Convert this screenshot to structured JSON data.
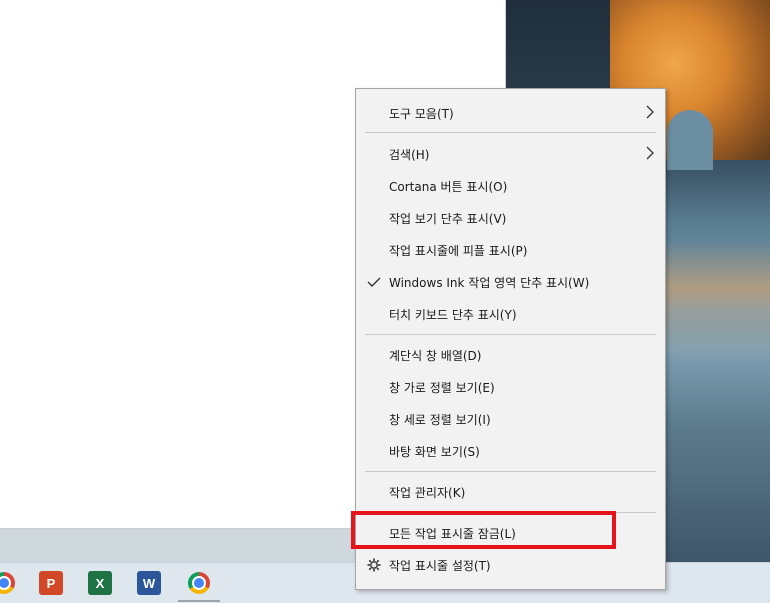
{
  "context_menu": {
    "items": {
      "toolbars": "도구 모음(T)",
      "search": "검색(H)",
      "cortana": "Cortana 버튼 표시(O)",
      "task_view": "작업 보기 단추 표시(V)",
      "people": "작업 표시줄에 피플 표시(P)",
      "windows_ink": "Windows Ink 작업 영역 단추 표시(W)",
      "touch_keyboard": "터치 키보드 단추 표시(Y)",
      "cascade": "계단식 창 배열(D)",
      "stacked": "창 가로 정렬 보기(E)",
      "side_by_side": "창 세로 정렬 보기(I)",
      "show_desktop": "바탕 화면 보기(S)",
      "task_manager": "작업 관리자(K)",
      "lock_taskbar": "모든 작업 표시줄 잠금(L)",
      "taskbar_settings": "작업 표시줄 설정(T)"
    },
    "checked_item": "windows_ink",
    "highlighted_item": "lock_taskbar"
  },
  "taskbar": {
    "icons": [
      "chrome-icon",
      "powerpoint-icon",
      "excel-icon",
      "word-icon",
      "chrome-icon"
    ],
    "powerpoint_letter": "P",
    "excel_letter": "X",
    "word_letter": "W"
  },
  "colors": {
    "highlight_outline": "#e5141b",
    "menu_background": "#f2f2f2",
    "taskbar_background": "#dfe7ee"
  }
}
